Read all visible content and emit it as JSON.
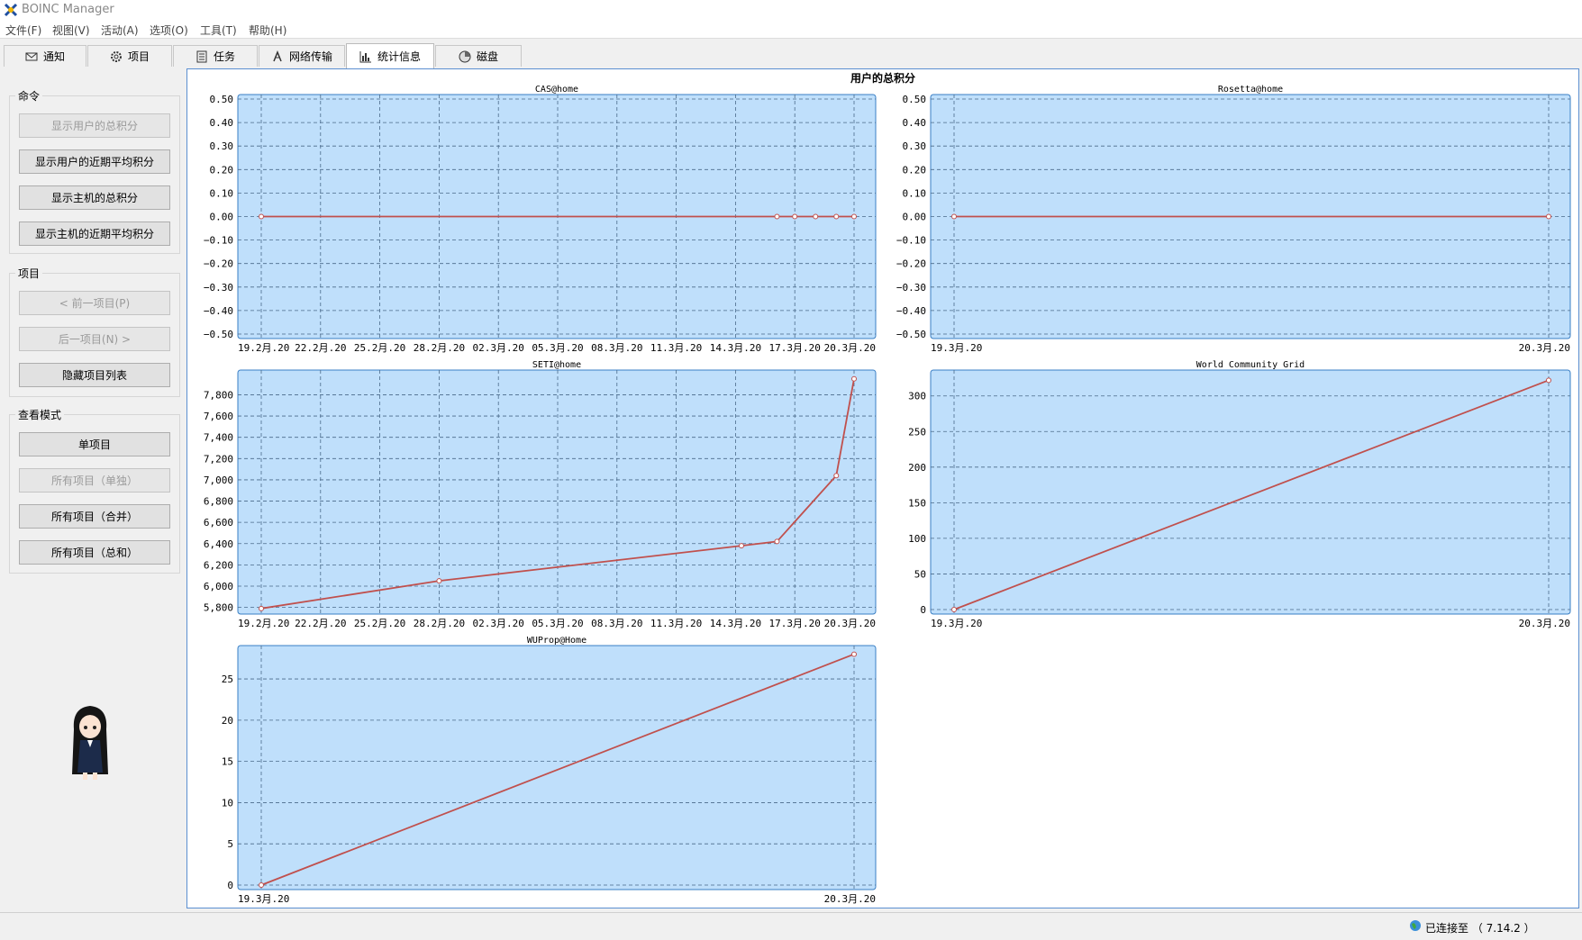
{
  "window": {
    "title": "BOINC Manager"
  },
  "menu": [
    "文件(F)",
    "视图(V)",
    "活动(A)",
    "选项(O)",
    "工具(T)",
    "帮助(H)"
  ],
  "tabs": [
    {
      "label": "通知",
      "icon": "mail-icon"
    },
    {
      "label": "项目",
      "icon": "gear-icon"
    },
    {
      "label": "任务",
      "icon": "document-icon"
    },
    {
      "label": "网络传输",
      "icon": "transfer-icon"
    },
    {
      "label": "统计信息",
      "icon": "bar-chart-icon",
      "active": true
    },
    {
      "label": "磁盘",
      "icon": "disk-icon"
    }
  ],
  "sidebar": {
    "commands": {
      "title": "命令",
      "buttons": [
        {
          "label": "显示用户的总积分",
          "disabled": true
        },
        {
          "label": "显示用户的近期平均积分",
          "disabled": false
        },
        {
          "label": "显示主机的总积分",
          "disabled": false
        },
        {
          "label": "显示主机的近期平均积分",
          "disabled": false
        }
      ]
    },
    "projects": {
      "title": "项目",
      "buttons": [
        {
          "label": "< 前一项目(P)",
          "disabled": true
        },
        {
          "label": "后一项目(N) >",
          "disabled": true
        },
        {
          "label": "隐藏项目列表",
          "disabled": false
        }
      ]
    },
    "view_mode": {
      "title": "查看模式",
      "buttons": [
        {
          "label": "单项目",
          "disabled": false
        },
        {
          "label": "所有项目（单独）",
          "disabled": true
        },
        {
          "label": "所有项目（合并）",
          "disabled": false
        },
        {
          "label": "所有项目（总和）",
          "disabled": false
        }
      ]
    }
  },
  "stats": {
    "title": "用户的总积分"
  },
  "colors": {
    "plot_bg": "#bfdffb",
    "line": "#c0504d",
    "frame": "#3a7fc4"
  },
  "chart_data": [
    {
      "type": "line",
      "title": "CAS@home",
      "x": [
        "19.2月.20",
        "22.2月.20",
        "25.2月.20",
        "28.2月.20",
        "02.3月.20",
        "05.3月.20",
        "08.3月.20",
        "11.3月.20",
        "14.3月.20",
        "17.3月.20",
        "20.3月.20"
      ],
      "xticks": [
        "19.2月.20",
        "22.2月.20",
        "25.2月.20",
        "28.2月.20",
        "02.3月.20",
        "05.3月.20",
        "08.3月.20",
        "11.3月.20",
        "14.3月.20",
        "17.3月.20",
        "20.3月.20"
      ],
      "yticks": [
        "0.50",
        "0.40",
        "0.30",
        "0.20",
        "0.10",
        "0.00",
        "−0.10",
        "−0.20",
        "−0.30",
        "−0.40",
        "−0.50"
      ],
      "ylim": [
        -0.5,
        0.5
      ],
      "points": [
        [
          0,
          0
        ],
        [
          8.7,
          0
        ],
        [
          9,
          0
        ],
        [
          9.35,
          0
        ],
        [
          9.7,
          0
        ],
        [
          10,
          0
        ]
      ],
      "grid": true
    },
    {
      "type": "line",
      "title": "Rosetta@home",
      "xticks": [
        "19.3月.20",
        "20.3月.20"
      ],
      "yticks": [
        "0.50",
        "0.40",
        "0.30",
        "0.20",
        "0.10",
        "0.00",
        "−0.10",
        "−0.20",
        "−0.30",
        "−0.40",
        "−0.50"
      ],
      "ylim": [
        -0.5,
        0.5
      ],
      "points": [
        [
          0,
          0
        ],
        [
          1,
          0
        ]
      ],
      "grid": true
    },
    {
      "type": "line",
      "title": "SETI@home",
      "xticks": [
        "19.2月.20",
        "22.2月.20",
        "25.2月.20",
        "28.2月.20",
        "02.3月.20",
        "05.3月.20",
        "08.3月.20",
        "11.3月.20",
        "14.3月.20",
        "17.3月.20",
        "20.3月.20"
      ],
      "yticks": [
        "7,800",
        "7,600",
        "7,400",
        "7,200",
        "7,000",
        "6,800",
        "6,600",
        "6,400",
        "6,200",
        "6,000",
        "5,800"
      ],
      "ylim": [
        5780,
        7990
      ],
      "points": [
        [
          0,
          5790
        ],
        [
          3,
          6050
        ],
        [
          8.1,
          6380
        ],
        [
          8.7,
          6420
        ],
        [
          9.7,
          7040
        ],
        [
          10,
          7950
        ]
      ],
      "grid": true
    },
    {
      "type": "line",
      "title": "World Community Grid",
      "xticks": [
        "19.3月.20",
        "20.3月.20"
      ],
      "yticks": [
        "300",
        "250",
        "200",
        "150",
        "100",
        "50",
        "0"
      ],
      "ylim": [
        0,
        330
      ],
      "points": [
        [
          0,
          0
        ],
        [
          1,
          322
        ]
      ],
      "grid": true
    },
    {
      "type": "line",
      "title": "WUProp@Home",
      "xticks": [
        "19.3月.20",
        "20.3月.20"
      ],
      "yticks": [
        "25",
        "20",
        "15",
        "10",
        "5",
        "0"
      ],
      "ylim": [
        0,
        28.5
      ],
      "points": [
        [
          0,
          0
        ],
        [
          1,
          28
        ]
      ],
      "grid": true
    }
  ],
  "status": {
    "text": "已连接至 （ 7.14.2 ）"
  }
}
